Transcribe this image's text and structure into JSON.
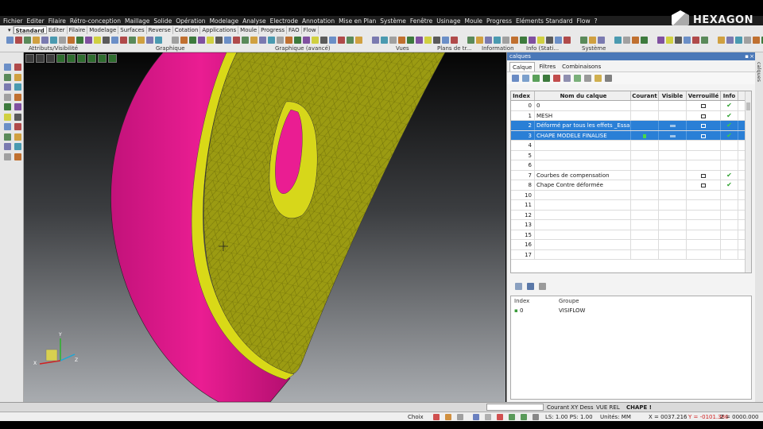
{
  "menu": [
    "Fichier",
    "Editer",
    "Filaire",
    "Rétro-conception",
    "Maillage",
    "Solide",
    "Opération",
    "Modelage",
    "Analyse",
    "Electrode",
    "Annotation",
    "Mise en Plan",
    "Système",
    "Fenêtre",
    "Usinage",
    "Moule",
    "Progress",
    "Eléments Standard",
    "Flow",
    "?"
  ],
  "brand": "HEXAGON",
  "ribbon": {
    "tabs": [
      "Standard",
      "Editer",
      "Filaire",
      "Modelage",
      "Surfaces",
      "Reverse",
      "Cotation",
      "Applications",
      "Moule",
      "Progress",
      "FAO",
      "Flow"
    ],
    "active_tab": "Standard",
    "groups": [
      "Attributs/Visibilité",
      "Graphique",
      "Graphique (avancé)",
      "Vues",
      "Plans de tr...",
      "Information",
      "Info (Stati...",
      "Système"
    ]
  },
  "panel": {
    "title": "calques",
    "pin": "▪",
    "close": "×",
    "tabs": [
      "Calque",
      "Filtres",
      "Combinaisons"
    ],
    "active_tab": "Calque",
    "side_label": "calques",
    "columns": {
      "index": "Index",
      "name": "Nom du calque",
      "current": "Courant",
      "visible": "Visible",
      "locked": "Verrouillé",
      "info": "Info"
    },
    "rows": [
      {
        "index": "0",
        "name": "0",
        "locked": true,
        "info": true,
        "selected": false
      },
      {
        "index": "1",
        "name": "MESH",
        "locked": true,
        "info": true,
        "selected": false
      },
      {
        "index": "2",
        "name": "Déformé par tous les effets _Essai",
        "visible": true,
        "locked": true,
        "info": true,
        "selected": true
      },
      {
        "index": "3",
        "name": "CHAPE MODELE FINALISE",
        "current": true,
        "visible": true,
        "locked": true,
        "info": true,
        "selected": true
      },
      {
        "index": "4",
        "name": ""
      },
      {
        "index": "5",
        "name": ""
      },
      {
        "index": "6",
        "name": ""
      },
      {
        "index": "7",
        "name": "Courbes de compensation",
        "locked": true,
        "info": true
      },
      {
        "index": "8",
        "name": "Chape Contre déformée",
        "locked": true,
        "info": true
      },
      {
        "index": "10",
        "name": ""
      },
      {
        "index": "11",
        "name": ""
      },
      {
        "index": "12",
        "name": ""
      },
      {
        "index": "13",
        "name": ""
      },
      {
        "index": "15",
        "name": ""
      },
      {
        "index": "16",
        "name": ""
      },
      {
        "index": "17",
        "name": ""
      }
    ],
    "group_columns": {
      "index": "Index",
      "group": "Groupe"
    },
    "groups": [
      {
        "index": "0",
        "group": "VISIFLOW"
      }
    ]
  },
  "status": {
    "current": "Courant XY Dess",
    "view": "VUE REL",
    "layer": "CHAPE !",
    "mode": "Choix",
    "ls_ps": "LS: 1.00 PS: 1.00",
    "units": "Unités: MM",
    "x_label": "X = 0037.216",
    "y_label": "Y = -0101.386",
    "z_label": "Z = 0000.000"
  },
  "axis": {
    "x": "X",
    "y": "Y",
    "z": "Z"
  },
  "check": "✔",
  "colors": {
    "pink": "#e0198c",
    "olive": "#9a9a10",
    "select": "#2a7fd6",
    "title": "#4a78b8"
  }
}
